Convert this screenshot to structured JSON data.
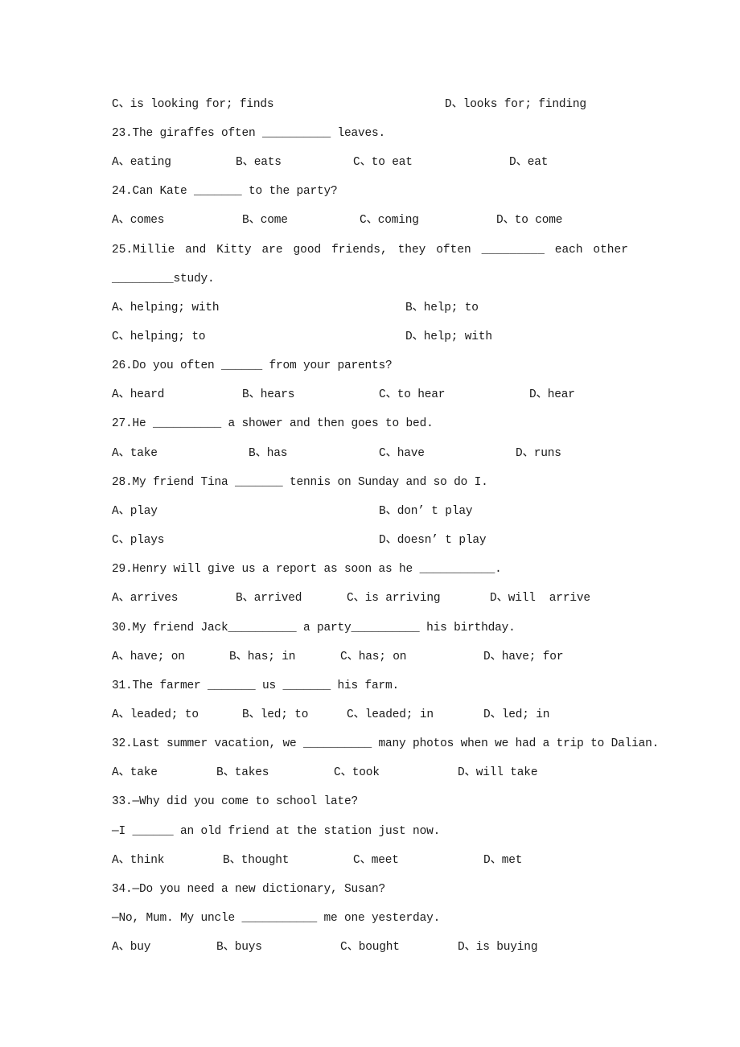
{
  "document": {
    "carryover_options": [
      {
        "label": "C、is looking for; finds"
      },
      {
        "label": "D、looks for; finding"
      }
    ],
    "questions": [
      {
        "number": "23",
        "stem": "23.The giraffes often __________ leaves.",
        "options": [
          "A、eating",
          "B、eats",
          "C、to eat",
          "D、eat"
        ]
      },
      {
        "number": "24",
        "stem": "24.Can Kate _______ to the party?",
        "options": [
          "A、comes",
          "B、come",
          "C、coming",
          "D、to come"
        ]
      },
      {
        "number": "25",
        "stem_words": [
          "25.Millie",
          "and",
          "Kitty",
          "are",
          "good",
          "friends,",
          "they",
          "often",
          "_________",
          "each",
          "other"
        ],
        "stem_line2": "_________study.",
        "options": [
          "A、helping; with",
          "B、help; to",
          "C、helping; to",
          "D、help; with"
        ]
      },
      {
        "number": "26",
        "stem": "26.Do you often ______ from your parents?",
        "options": [
          "A、heard",
          "B、hears",
          "C、to hear",
          "D、hear"
        ]
      },
      {
        "number": "27",
        "stem": "27.He __________ a shower and then goes to bed.",
        "options": [
          "A、take",
          "B、has",
          "C、have",
          "D、runs"
        ]
      },
      {
        "number": "28",
        "stem": "28.My friend Tina _______ tennis on Sunday and so do I.",
        "options": [
          "A、play",
          "B、don’ t play",
          "C、plays",
          "D、doesn’ t play"
        ]
      },
      {
        "number": "29",
        "stem": "29.Henry will give us a report as soon as he ___________.",
        "options": [
          "A、arrives",
          "B、arrived",
          "C、is arriving",
          "D、will  arrive"
        ]
      },
      {
        "number": "30",
        "stem": "30.My friend Jack__________ a party__________ his birthday.",
        "options": [
          "A、have; on",
          "B、has; in",
          "C、has; on",
          "D、have; for"
        ]
      },
      {
        "number": "31",
        "stem": "31.The farmer _______ us _______ his farm.",
        "options": [
          "A、leaded; to",
          "B、led; to",
          "C、leaded; in",
          "D、led; in"
        ]
      },
      {
        "number": "32",
        "stem": "32.Last summer vacation, we __________ many photos when we had a trip to Dalian.",
        "options": [
          "A、take",
          "B、takes",
          "C、took",
          "D、will take"
        ]
      },
      {
        "number": "33",
        "stem": "33.—Why did you come to school late?",
        "stem_line2": "—I ______ an old friend at the station just now.",
        "options": [
          "A、think",
          "B、thought",
          "C、meet",
          "D、met"
        ]
      },
      {
        "number": "34",
        "stem": "34.—Do you need a new dictionary, Susan?",
        "stem_line2": "—No, Mum. My uncle ___________ me one yesterday.",
        "options": [
          "A、buy",
          "B、buys",
          "C、bought",
          "D、is buying"
        ]
      }
    ]
  }
}
